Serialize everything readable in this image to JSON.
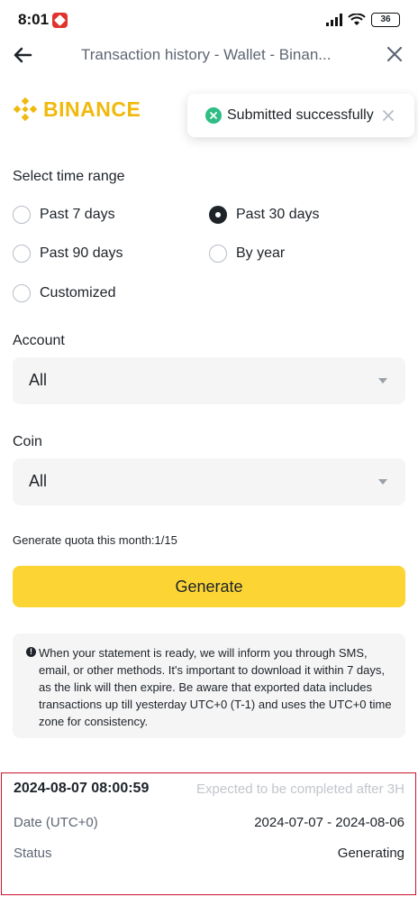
{
  "status_bar": {
    "time": "8:01",
    "battery": "36"
  },
  "header": {
    "title": "Transaction history - Wallet - Binan..."
  },
  "brand": {
    "name": "BINANCE",
    "color": "#f0b90b"
  },
  "toast": {
    "message": "Submitted successfully",
    "icon": "check-circle-icon",
    "color": "#2ebd85"
  },
  "time_range": {
    "label": "Select time range",
    "options": [
      {
        "label": "Past 7 days",
        "selected": false
      },
      {
        "label": "Past 30 days",
        "selected": true
      },
      {
        "label": "Past 90 days",
        "selected": false
      },
      {
        "label": "By year",
        "selected": false
      },
      {
        "label": "Customized",
        "selected": false
      }
    ]
  },
  "account": {
    "label": "Account",
    "value": "All"
  },
  "coin": {
    "label": "Coin",
    "value": "All"
  },
  "quota": {
    "text": "Generate quota this month:1/15"
  },
  "generate": {
    "label": "Generate",
    "color": "#fcd535"
  },
  "notice": {
    "text": "When your statement is ready, we will inform you through SMS, email, or other methods. It's important to download it within 7 days, as the link will then expire. Be aware that exported data includes transactions up till yesterday UTC+0 (T-1) and uses the UTC+0 time zone for consistency."
  },
  "record": {
    "created": "2024-08-07 08:00:59",
    "expected": "Expected to be completed after 3H",
    "date_label": "Date (UTC+0)",
    "date_value": "2024-07-07 - 2024-08-06",
    "status_label": "Status",
    "status_value": "Generating",
    "highlight_color": "#c9132c"
  }
}
